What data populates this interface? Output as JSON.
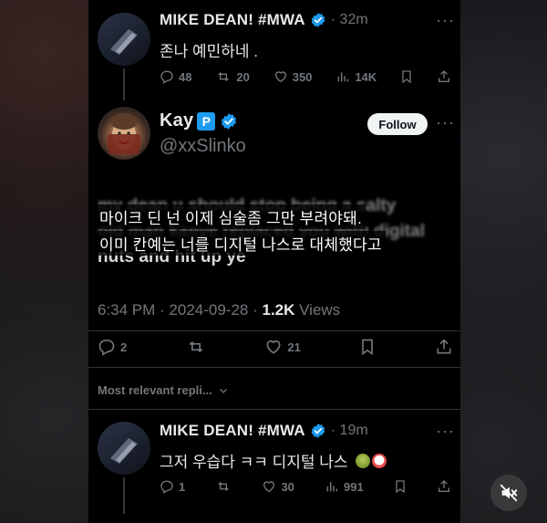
{
  "reply_top": {
    "author": "MIKE DEAN! #MWA",
    "time": "· 32m",
    "text": "존나 예민하네 .",
    "stats": {
      "replies": "48",
      "reposts": "20",
      "likes": "350",
      "views": "14K"
    }
  },
  "main_tweet": {
    "author": "Kay",
    "badge": "P",
    "handle": "@xxSlinko",
    "follow_label": "Follow",
    "text_line1": "my dean u should stop being a salty",
    "text_line2": "old man kanye replaced you with digital",
    "text_line3": "nuts and hit up ye",
    "subtitle_line1": "마이크 딘 넌 이제 심술좀 그만 부려야돼.",
    "subtitle_line2": "이미 칸예는 너를 디지털 나스로 대체했다고",
    "timestamp": "6:34 PM · 2024-09-28 · ",
    "views_count": "1.2K",
    "views_label": " Views",
    "stats": {
      "replies": "2",
      "likes": "21"
    }
  },
  "most_relevant_label": "Most relevant repli...",
  "reply_bottom": {
    "author": "MIKE DEAN! #MWA",
    "time": "· 19m",
    "text": "그저 우습다 ㅋㅋ 디지털 나스",
    "stats": {
      "replies": "1",
      "likes": "30",
      "views": "991"
    }
  },
  "colors": {
    "accent": "#1d9bf0",
    "muted": "#71767b",
    "text": "#e7e9ea"
  },
  "icons": [
    "more-icon",
    "verified-icon",
    "reply-icon",
    "repost-icon",
    "like-icon",
    "views-icon",
    "bookmark-icon",
    "share-icon",
    "chevron-down-icon",
    "mute-icon"
  ]
}
